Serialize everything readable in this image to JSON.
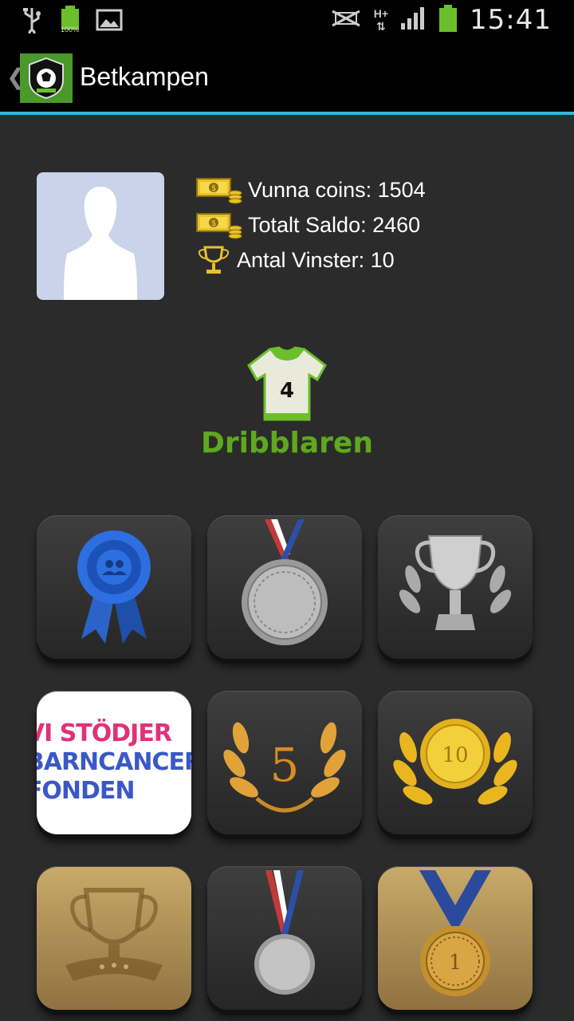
{
  "status_bar": {
    "time": "15:41",
    "battery_small_label": "100%",
    "network_label": "H+"
  },
  "action_bar": {
    "title": "Betkampen"
  },
  "profile": {
    "stats": [
      {
        "label": "Vunna coins: 1504",
        "icon": "coins-icon"
      },
      {
        "label": "Totalt Saldo: 2460",
        "icon": "coins-icon"
      },
      {
        "label": "Antal Vinster: 10",
        "icon": "trophy-icon"
      }
    ]
  },
  "rank": {
    "jersey_number": "4",
    "title": "Dribblaren"
  },
  "badges": {
    "charity_line1": "VI STÖDJER",
    "charity_line2": "BARNCANCER",
    "charity_line3": "FONDEN",
    "laurel_5_number": "5",
    "gold_medal_number": "10",
    "gold_medal_1_number": "1"
  },
  "colors": {
    "accent": "#33b5e5",
    "rank_green": "#5fa81f",
    "background": "#2b2b2b"
  }
}
